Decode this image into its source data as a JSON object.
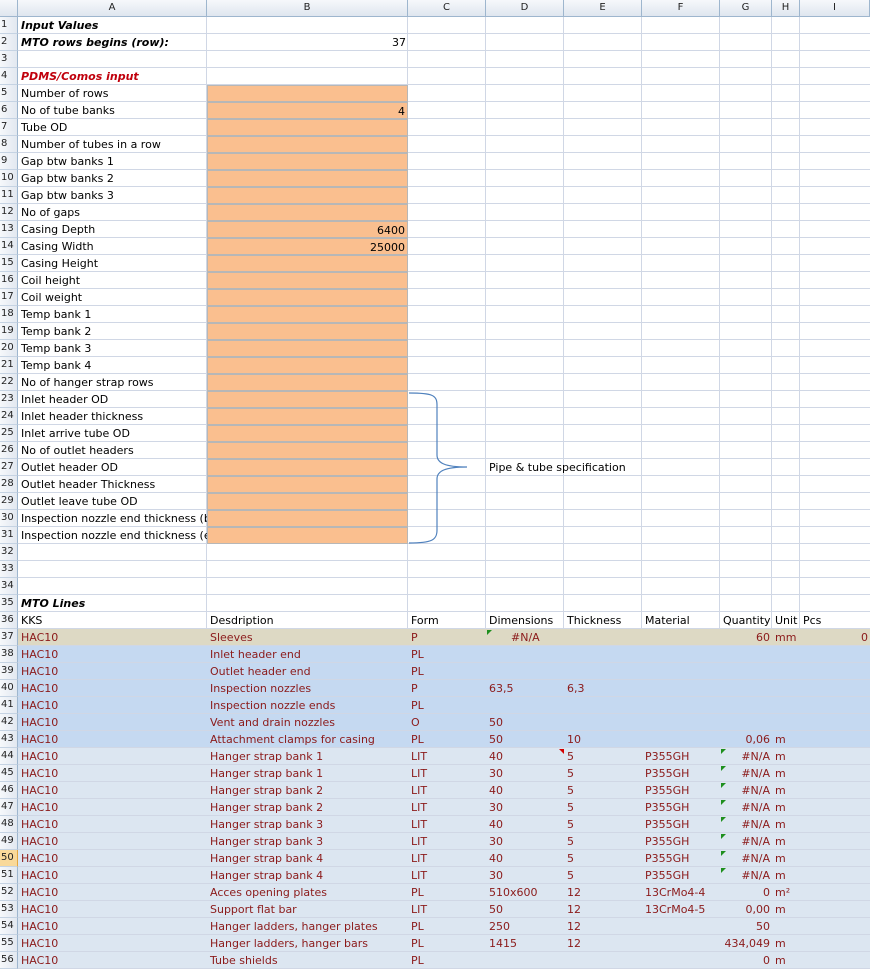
{
  "columns": [
    "A",
    "B",
    "C",
    "D",
    "E",
    "F",
    "G",
    "H",
    "I"
  ],
  "rows": {
    "r1": {
      "num": "1",
      "a": "Input Values"
    },
    "r2": {
      "num": "2",
      "a": "MTO rows begins (row):",
      "c": "37"
    },
    "r3": {
      "num": "3"
    },
    "r4": {
      "num": "4",
      "a": "PDMS/Comos input"
    },
    "inputs": [
      {
        "num": "5",
        "a": "Number of rows",
        "b": ""
      },
      {
        "num": "6",
        "a": "No of tube banks",
        "b": "4"
      },
      {
        "num": "7",
        "a": "Tube OD",
        "b": ""
      },
      {
        "num": "8",
        "a": "Number of tubes in a row",
        "b": ""
      },
      {
        "num": "9",
        "a": "Gap btw banks 1",
        "b": ""
      },
      {
        "num": "10",
        "a": "Gap btw banks 2",
        "b": ""
      },
      {
        "num": "11",
        "a": "Gap btw banks 3",
        "b": ""
      },
      {
        "num": "12",
        "a": "No of gaps",
        "b": ""
      },
      {
        "num": "13",
        "a": "Casing Depth",
        "b": "6400"
      },
      {
        "num": "14",
        "a": "Casing Width",
        "b": "25000"
      },
      {
        "num": "15",
        "a": "Casing Height",
        "b": ""
      },
      {
        "num": "16",
        "a": "Coil height",
        "b": ""
      },
      {
        "num": "17",
        "a": "Coil weight",
        "b": ""
      },
      {
        "num": "18",
        "a": "Temp bank 1",
        "b": ""
      },
      {
        "num": "19",
        "a": "Temp bank 2",
        "b": ""
      },
      {
        "num": "20",
        "a": "Temp bank 3",
        "b": ""
      },
      {
        "num": "21",
        "a": "Temp bank 4",
        "b": ""
      },
      {
        "num": "22",
        "a": "No of hanger strap rows",
        "b": ""
      },
      {
        "num": "23",
        "a": "Inlet header OD",
        "b": ""
      },
      {
        "num": "24",
        "a": "Inlet header thickness",
        "b": ""
      },
      {
        "num": "25",
        "a": "Inlet arrive tube OD",
        "b": ""
      },
      {
        "num": "26",
        "a": "No of outlet headers",
        "b": ""
      },
      {
        "num": "27",
        "a": "Outlet header OD",
        "b": ""
      },
      {
        "num": "28",
        "a": "Outlet header Thickness",
        "b": ""
      },
      {
        "num": "29",
        "a": "Outlet leave tube OD",
        "b": ""
      },
      {
        "num": "30",
        "a": "Inspection nozzle end thickness (body pipe)",
        "b": ""
      },
      {
        "num": "31",
        "a": "Inspection nozzle end thickness (end)",
        "b": ""
      }
    ],
    "pipe_spec": "Pipe & tube specification",
    "r32": {
      "num": "32"
    },
    "r33": {
      "num": "33"
    },
    "r34": {
      "num": "34"
    },
    "r35": {
      "num": "35",
      "a": "MTO Lines"
    },
    "header": {
      "num": "36",
      "a": "KKS",
      "b": "Desdription",
      "c": "Form",
      "d": "Dimensions",
      "e": "Thickness",
      "f": "Material",
      "g": "Quantity",
      "h": "Unit",
      "i": "Pcs"
    },
    "mto": [
      {
        "num": "37",
        "a": "HAC10",
        "b": "Sleeves",
        "c": "P",
        "d": "#N/A",
        "e": "",
        "f": "",
        "g": "60",
        "h": "mm",
        "i": "0"
      },
      {
        "num": "38",
        "a": "HAC10",
        "b": "Inlet header end",
        "c": "PL",
        "d": "",
        "e": "",
        "f": "",
        "g": "",
        "h": "",
        "i": ""
      },
      {
        "num": "39",
        "a": "HAC10",
        "b": "Outlet header end",
        "c": "PL",
        "d": "",
        "e": "",
        "f": "",
        "g": "",
        "h": "",
        "i": ""
      },
      {
        "num": "40",
        "a": "HAC10",
        "b": "Inspection nozzles",
        "c": "P",
        "d": "63,5",
        "e": "6,3",
        "f": "",
        "g": "",
        "h": "",
        "i": ""
      },
      {
        "num": "41",
        "a": "HAC10",
        "b": "Inspection nozzle ends",
        "c": "PL",
        "d": "",
        "e": "",
        "f": "",
        "g": "",
        "h": "",
        "i": ""
      },
      {
        "num": "42",
        "a": "HAC10",
        "b": "Vent and drain nozzles",
        "c": "O",
        "d": "50",
        "e": "",
        "f": "",
        "g": "",
        "h": "",
        "i": ""
      },
      {
        "num": "43",
        "a": "HAC10",
        "b": "Attachment clamps for casing",
        "c": "PL",
        "d": "50",
        "e": "10",
        "f": "",
        "g": "0,06",
        "h": "m",
        "i": ""
      },
      {
        "num": "44",
        "a": "HAC10",
        "b": "Hanger strap bank 1",
        "c": "LIT",
        "d": "40",
        "e": "5",
        "f": "P355GH",
        "g": "#N/A",
        "h": "m",
        "i": ""
      },
      {
        "num": "45",
        "a": "HAC10",
        "b": "Hanger strap bank 1",
        "c": "LIT",
        "d": "30",
        "e": "5",
        "f": "P355GH",
        "g": "#N/A",
        "h": "m",
        "i": ""
      },
      {
        "num": "46",
        "a": "HAC10",
        "b": "Hanger strap bank 2",
        "c": "LIT",
        "d": "40",
        "e": "5",
        "f": "P355GH",
        "g": "#N/A",
        "h": "m",
        "i": ""
      },
      {
        "num": "47",
        "a": "HAC10",
        "b": "Hanger strap bank 2",
        "c": "LIT",
        "d": "30",
        "e": "5",
        "f": "P355GH",
        "g": "#N/A",
        "h": "m",
        "i": ""
      },
      {
        "num": "48",
        "a": "HAC10",
        "b": "Hanger strap bank 3",
        "c": "LIT",
        "d": "40",
        "e": "5",
        "f": "P355GH",
        "g": "#N/A",
        "h": "m",
        "i": ""
      },
      {
        "num": "49",
        "a": "HAC10",
        "b": "Hanger strap bank 3",
        "c": "LIT",
        "d": "30",
        "e": "5",
        "f": "P355GH",
        "g": "#N/A",
        "h": "m",
        "i": ""
      },
      {
        "num": "50",
        "a": "HAC10",
        "b": "Hanger strap bank 4",
        "c": "LIT",
        "d": "40",
        "e": "5",
        "f": "P355GH",
        "g": "#N/A",
        "h": "m",
        "i": ""
      },
      {
        "num": "51",
        "a": "HAC10",
        "b": "Hanger strap bank 4",
        "c": "LIT",
        "d": "30",
        "e": "5",
        "f": "P355GH",
        "g": "#N/A",
        "h": "m",
        "i": ""
      },
      {
        "num": "52",
        "a": "HAC10",
        "b": "Acces opening plates",
        "c": "PL",
        "d": "510x600",
        "e": "12",
        "f": "13CrMo4-4",
        "g": "0",
        "h": "m²",
        "i": ""
      },
      {
        "num": "53",
        "a": "HAC10",
        "b": "Support flat bar",
        "c": "LIT",
        "d": "50",
        "e": "12",
        "f": "13CrMo4-5",
        "g": "0,00",
        "h": "m",
        "i": ""
      },
      {
        "num": "54",
        "a": "HAC10",
        "b": "Hanger ladders, hanger plates",
        "c": "PL",
        "d": "250",
        "e": "12",
        "f": "",
        "g": "50",
        "h": "",
        "i": ""
      },
      {
        "num": "55",
        "a": "HAC10",
        "b": "Hanger ladders, hanger bars",
        "c": "PL",
        "d": "1415",
        "e": "12",
        "f": "",
        "g": "434,049",
        "h": "m",
        "i": ""
      },
      {
        "num": "56",
        "a": "HAC10",
        "b": "Tube shields",
        "c": "PL",
        "d": "",
        "e": "",
        "f": "",
        "g": "0",
        "h": "m",
        "i": ""
      }
    ]
  },
  "colors": {
    "input_fill": "#fabf8f",
    "sleeves_fill": "#ddd9c4",
    "blue_fill": "#c5d9f1",
    "light_fill": "#dce6f1",
    "text_red": "#c0000c",
    "text_darkred": "#8b1a1a"
  }
}
